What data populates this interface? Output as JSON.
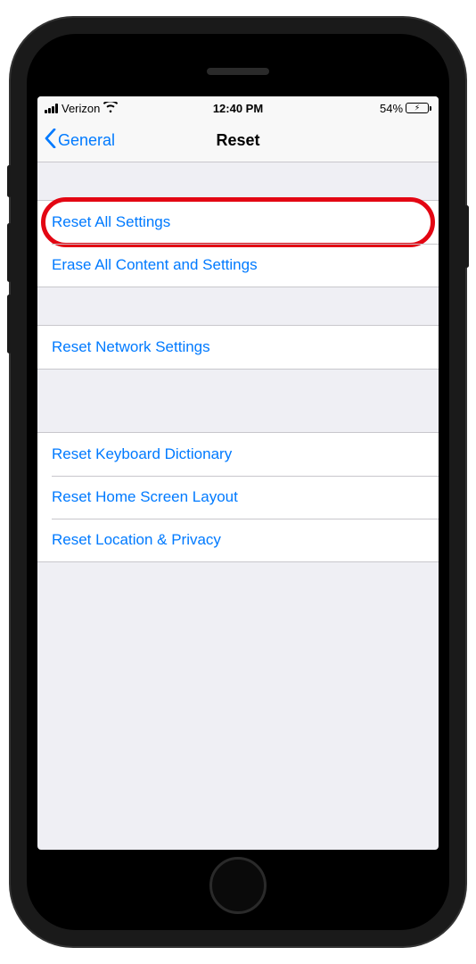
{
  "status_bar": {
    "carrier": "Verizon",
    "time": "12:40 PM",
    "battery_percent": "54%"
  },
  "nav": {
    "back_label": "General",
    "title": "Reset"
  },
  "groups": [
    {
      "items": [
        {
          "label": "Reset All Settings",
          "highlighted": true
        },
        {
          "label": "Erase All Content and Settings"
        }
      ]
    },
    {
      "items": [
        {
          "label": "Reset Network Settings"
        }
      ]
    },
    {
      "items": [
        {
          "label": "Reset Keyboard Dictionary"
        },
        {
          "label": "Reset Home Screen Layout"
        },
        {
          "label": "Reset Location & Privacy"
        }
      ]
    }
  ]
}
